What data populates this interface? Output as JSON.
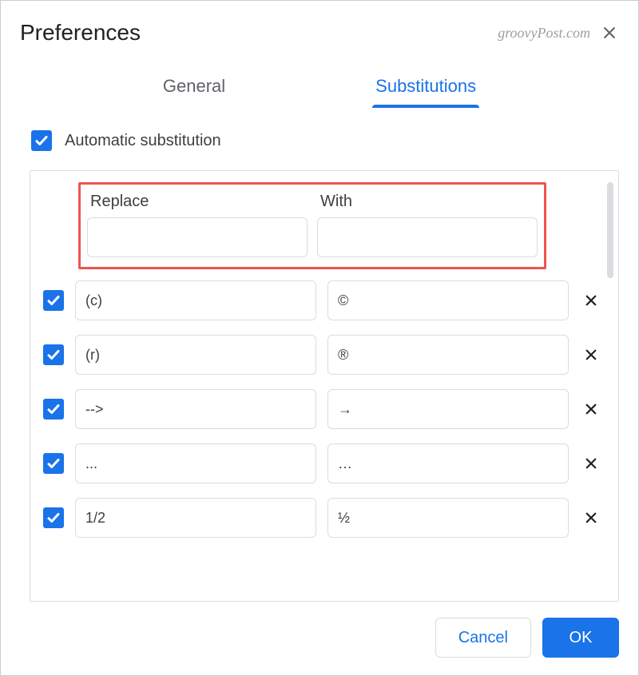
{
  "dialog": {
    "title": "Preferences",
    "watermark": "groovyPost.com"
  },
  "tabs": {
    "general": "General",
    "substitutions": "Substitutions"
  },
  "auto_substitution_label": "Automatic substitution",
  "columns": {
    "replace": "Replace",
    "with": "With"
  },
  "new_entry": {
    "replace": "",
    "with": ""
  },
  "rows": [
    {
      "replace": "(c)",
      "with": "©"
    },
    {
      "replace": "(r)",
      "with": "®"
    },
    {
      "replace": "-->",
      "with": "→"
    },
    {
      "replace": "...",
      "with": "…"
    },
    {
      "replace": "1/2",
      "with": "½"
    }
  ],
  "buttons": {
    "cancel": "Cancel",
    "ok": "OK"
  }
}
